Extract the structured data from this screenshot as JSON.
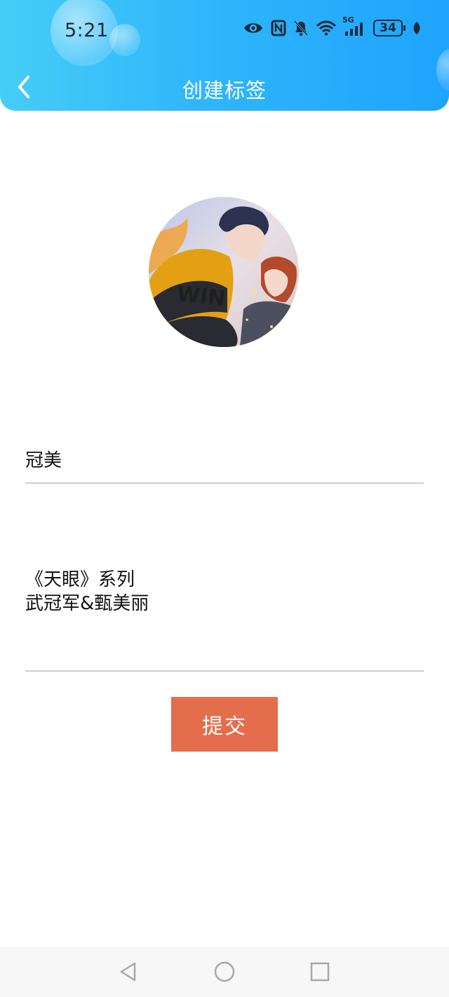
{
  "status_bar": {
    "time": "5:21",
    "network": "5G",
    "battery": "34",
    "icons": [
      "eye-icon",
      "nfc-icon",
      "bell-off-icon",
      "wifi-icon",
      "signal-icon",
      "battery-icon",
      "leaf-icon"
    ]
  },
  "header": {
    "title": "创建标签",
    "back_icon": "chevron-left-icon",
    "gradient_start": "#46cdf6",
    "gradient_end": "#1ea4fc"
  },
  "avatar": {
    "icon": "avatar-image",
    "text": "WIN"
  },
  "form": {
    "name_value": "冠美",
    "description_lines": [
      "《天眼》系列",
      "武冠军&甄美丽"
    ],
    "submit_label": "提交",
    "submit_color": "#e46e4c"
  },
  "nav_bar": {
    "icons": [
      "back-triangle-icon",
      "home-circle-icon",
      "recents-square-icon"
    ]
  }
}
